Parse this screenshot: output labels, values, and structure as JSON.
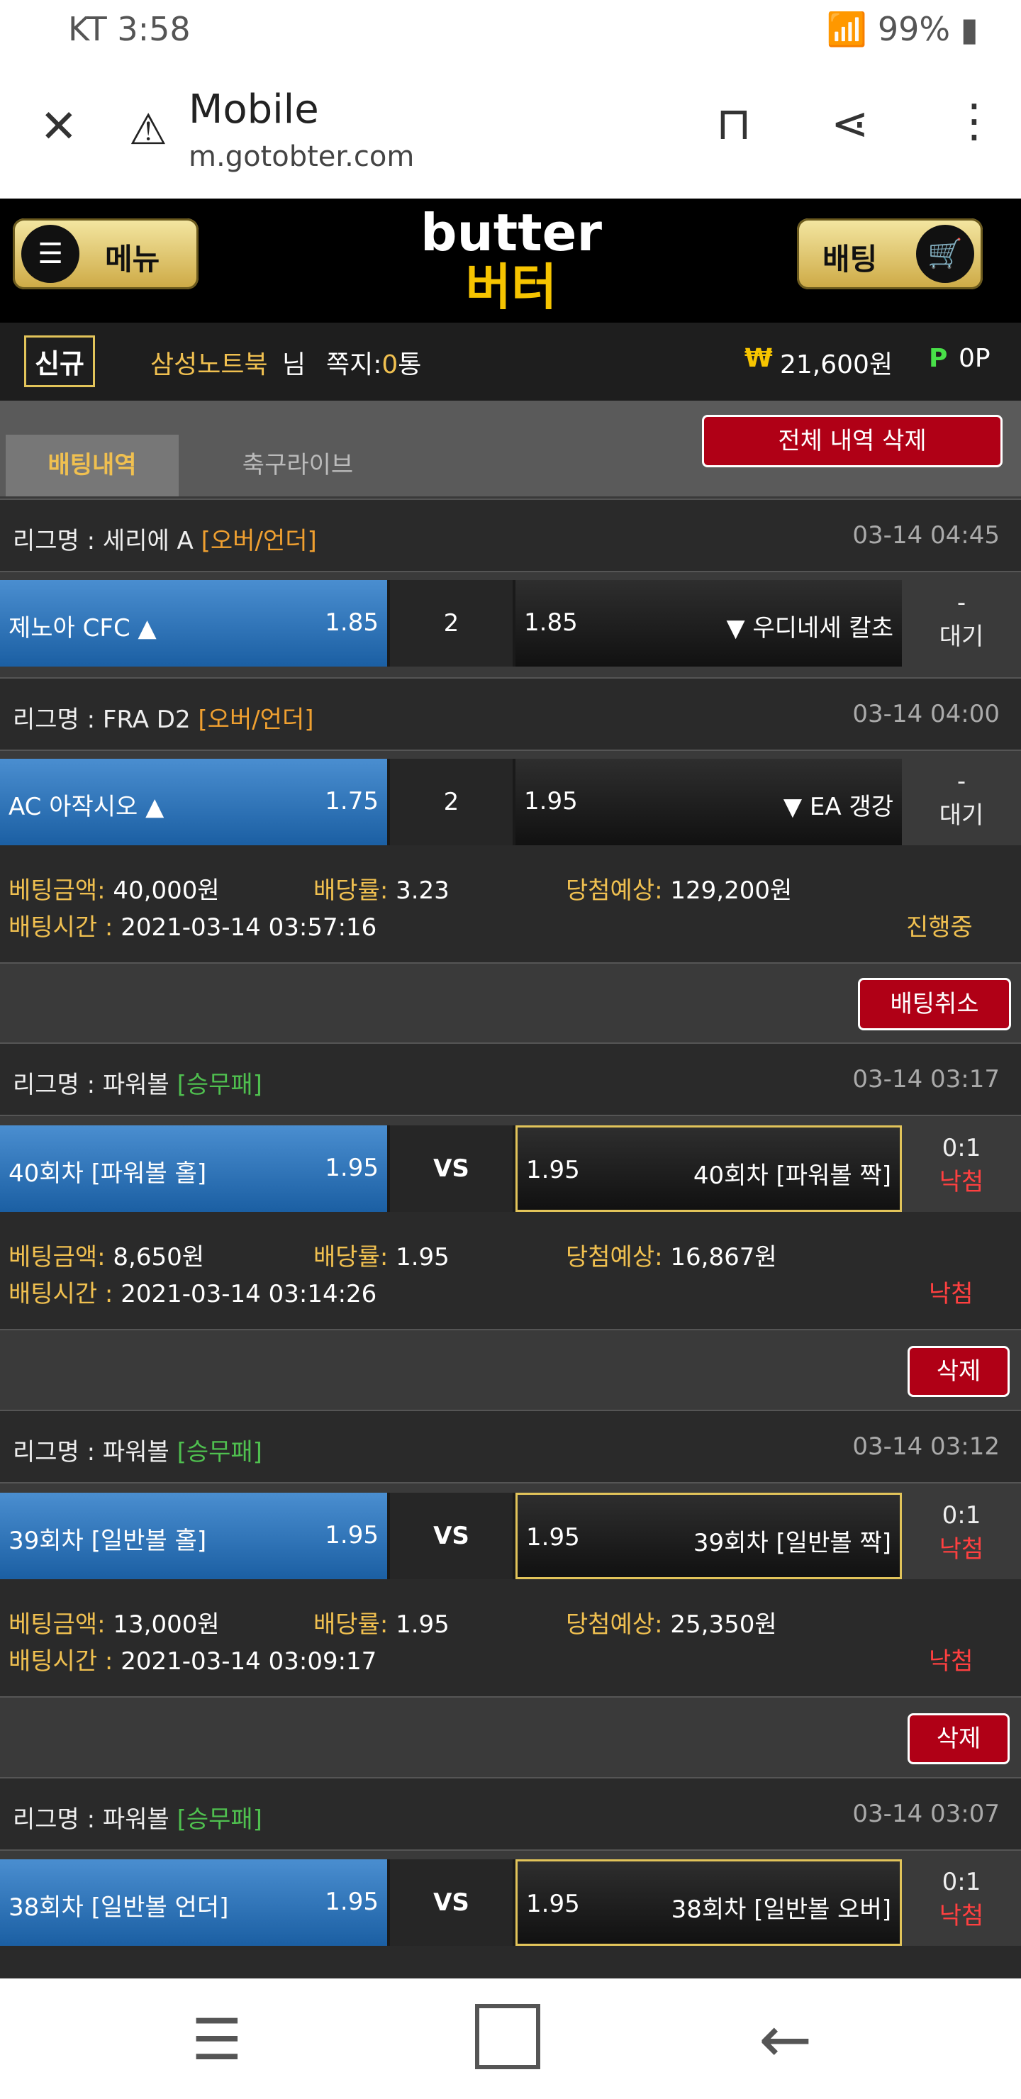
{
  "status": {
    "time": "KT 3:58",
    "right": "99%"
  },
  "browser": {
    "title": "Mobile",
    "url": "m.gotobter.com"
  },
  "site": {
    "menu": "메뉴",
    "betting": "배팅",
    "logo_en": "butter",
    "logo_ko": "버터"
  },
  "user": {
    "badge": "신규",
    "name": "삼성노트북",
    "name_suffix": "님",
    "msg_label": "쪽지:",
    "msg_count": "0",
    "msg_unit": "통",
    "money": "21,600원",
    "point": "0P"
  },
  "tabs": {
    "history": "배팅내역",
    "live": "축구라이브",
    "delete_all": "전체 내역 삭제"
  },
  "bets": [
    {
      "league": "리그명 : 세리에 A",
      "type": "[오버/언더]",
      "date": "03-14 04:45",
      "home": "제노아 CFC ▲",
      "home_odds": "1.85",
      "mid": "2",
      "away_odds": "1.85",
      "away": "▼ 우디네세 칼초",
      "res1": "-",
      "res2": "대기"
    },
    {
      "league": "리그명 : FRA D2",
      "type": "[오버/언더]",
      "date": "03-14 04:00",
      "home": "AC 아작시오 ▲",
      "home_odds": "1.75",
      "mid": "2",
      "away_odds": "1.95",
      "away": "▼ EA 갱강",
      "res1": "-",
      "res2": "대기"
    },
    {
      "league": "리그명 : 파워볼",
      "type": "[승무패]",
      "date": "03-14 03:17",
      "home": "40회차 [파워볼 홀]",
      "home_odds": "1.95",
      "mid": "VS",
      "away_odds": "1.95",
      "away": "40회차 [파워볼 짝]",
      "res1": "0:1",
      "res2": "낙첨"
    },
    {
      "league": "리그명 : 파워볼",
      "type": "[승무패]",
      "date": "03-14 03:12",
      "home": "39회차 [일반볼 홀]",
      "home_odds": "1.95",
      "mid": "VS",
      "away_odds": "1.95",
      "away": "39회차 [일반볼 짝]",
      "res1": "0:1",
      "res2": "낙첨"
    },
    {
      "league": "리그명 : 파워볼",
      "type": "[승무패]",
      "date": "03-14 03:07",
      "home": "38회차 [일반볼 언더]",
      "home_odds": "1.95",
      "mid": "VS",
      "away_odds": "1.95",
      "away": "38회차 [일반볼 오버]",
      "res1": "0:1",
      "res2": "낙첨"
    }
  ],
  "slips": [
    {
      "amount_label": "베팅금액:",
      "amount": "40,000원",
      "rate_label": "배당률:",
      "rate": "3.23",
      "win_label": "당첨예상:",
      "win": "129,200원",
      "time_label": "배팅시간 :",
      "time": "2021-03-14 03:57:16",
      "state": "진행중",
      "action": "배팅취소"
    },
    {
      "amount_label": "베팅금액:",
      "amount": "8,650원",
      "rate_label": "배당률:",
      "rate": "1.95",
      "win_label": "당첨예상:",
      "win": "16,867원",
      "time_label": "배팅시간 :",
      "time": "2021-03-14 03:14:26",
      "state": "낙첨",
      "action": "삭제"
    },
    {
      "amount_label": "베팅금액:",
      "amount": "13,000원",
      "rate_label": "배당률:",
      "rate": "1.95",
      "win_label": "당첨예상:",
      "win": "25,350원",
      "time_label": "배팅시간 :",
      "time": "2021-03-14 03:09:17",
      "state": "낙첨",
      "action": "삭제"
    }
  ]
}
